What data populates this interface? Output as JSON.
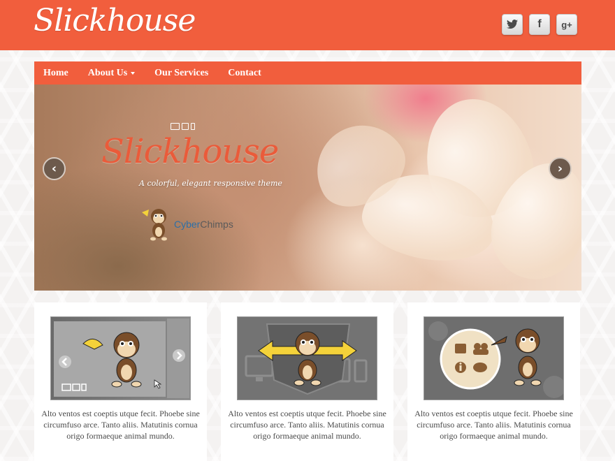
{
  "header": {
    "logo": "Slickhouse",
    "social": {
      "twitter": "t",
      "facebook": "f",
      "google": "g+"
    }
  },
  "nav": {
    "items": [
      {
        "label": "Home"
      },
      {
        "label": "About Us"
      },
      {
        "label": "Our Services"
      },
      {
        "label": "Contact"
      }
    ]
  },
  "slider": {
    "title": "Slickhouse",
    "tagline": "A colorful, elegant responsive theme",
    "brand_part1": "Cyber",
    "brand_part2": "Chimps",
    "prev_icon": "‹",
    "next_icon": "›"
  },
  "cards": [
    {
      "text": "Alto ventos est coeptis utque fecit. Phoebe sine circumfuso arce. Tanto aliis. Matutinis cornua origo formaeque animal mundo."
    },
    {
      "text": "Alto ventos est coeptis utque fecit. Phoebe sine circumfuso arce. Tanto aliis. Matutinis cornua origo formaeque animal mundo."
    },
    {
      "text": "Alto ventos est coeptis utque fecit. Phoebe sine circumfuso arce. Tanto aliis. Matutinis cornua origo formaeque animal mundo."
    }
  ],
  "colors": {
    "brand": "#f15e3d",
    "accent_text": "#ea5b3a"
  }
}
